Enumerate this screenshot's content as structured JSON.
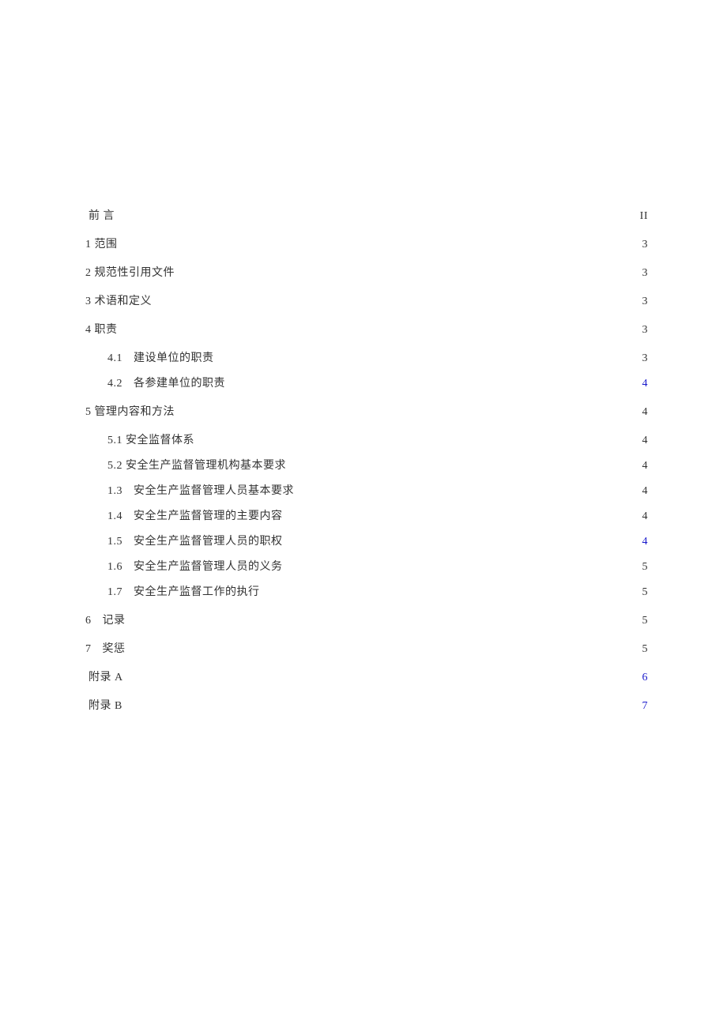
{
  "toc": [
    {
      "level": "l1",
      "num": "",
      "title": "前 言",
      "page": "II",
      "link": false,
      "padTitle": false
    },
    {
      "level": "l1",
      "num": "1",
      "title": "范围",
      "page": "3",
      "link": false,
      "padTitle": false
    },
    {
      "level": "l1",
      "num": "2",
      "title": "规范性引用文件",
      "page": "3",
      "link": false,
      "padTitle": false
    },
    {
      "level": "l1",
      "num": "3",
      "title": "术语和定义",
      "page": "3",
      "link": false,
      "padTitle": false
    },
    {
      "level": "l1",
      "num": "4",
      "title": "职责",
      "page": "3",
      "link": false,
      "padTitle": false
    },
    {
      "level": "l2",
      "num": "4.1",
      "title": "建设单位的职责",
      "page": "3",
      "link": false,
      "padTitle": true,
      "tight": true
    },
    {
      "level": "l2",
      "num": "4.2",
      "title": "各参建单位的职责",
      "page": "4",
      "link": true,
      "padTitle": true
    },
    {
      "level": "l1",
      "num": "5",
      "title": "管理内容和方法",
      "page": "4",
      "link": false,
      "padTitle": false
    },
    {
      "level": "l2",
      "num": "5.1",
      "title": "安全监督体系",
      "page": "4",
      "link": false,
      "padTitle": false,
      "tight": true
    },
    {
      "level": "l2",
      "num": "5.2",
      "title": "安全生产监督管理机构基本要求",
      "page": "4",
      "link": false,
      "padTitle": false,
      "tight": true
    },
    {
      "level": "l2",
      "num": "1.3",
      "title": "安全生产监督管理人员基本要求",
      "page": "4",
      "link": false,
      "padTitle": true,
      "tight": true
    },
    {
      "level": "l2",
      "num": "1.4",
      "title": "安全生产监督管理的主要内容",
      "page": "4",
      "link": false,
      "padTitle": true,
      "tight": true
    },
    {
      "level": "l2",
      "num": "1.5",
      "title": "安全生产监督管理人员的职权",
      "page": "4",
      "link": true,
      "padTitle": true,
      "tight": true
    },
    {
      "level": "l2",
      "num": "1.6",
      "title": "安全生产监督管理人员的义务",
      "page": "5",
      "link": false,
      "padTitle": true,
      "tight": true
    },
    {
      "level": "l2",
      "num": "1.7",
      "title": "安全生产监督工作的执行",
      "page": "5",
      "link": false,
      "padTitle": true
    },
    {
      "level": "l1",
      "num": "6",
      "title": "记录",
      "page": "5",
      "link": false,
      "padTitle": true
    },
    {
      "level": "l1",
      "num": "7",
      "title": "奖惩",
      "page": "5",
      "link": false,
      "padTitle": true
    },
    {
      "level": "l1",
      "num": "",
      "title": "附录 A",
      "page": "6",
      "link": true,
      "padTitle": false
    },
    {
      "level": "l1",
      "num": "",
      "title": "附录 B",
      "page": "7",
      "link": true,
      "padTitle": false
    }
  ]
}
